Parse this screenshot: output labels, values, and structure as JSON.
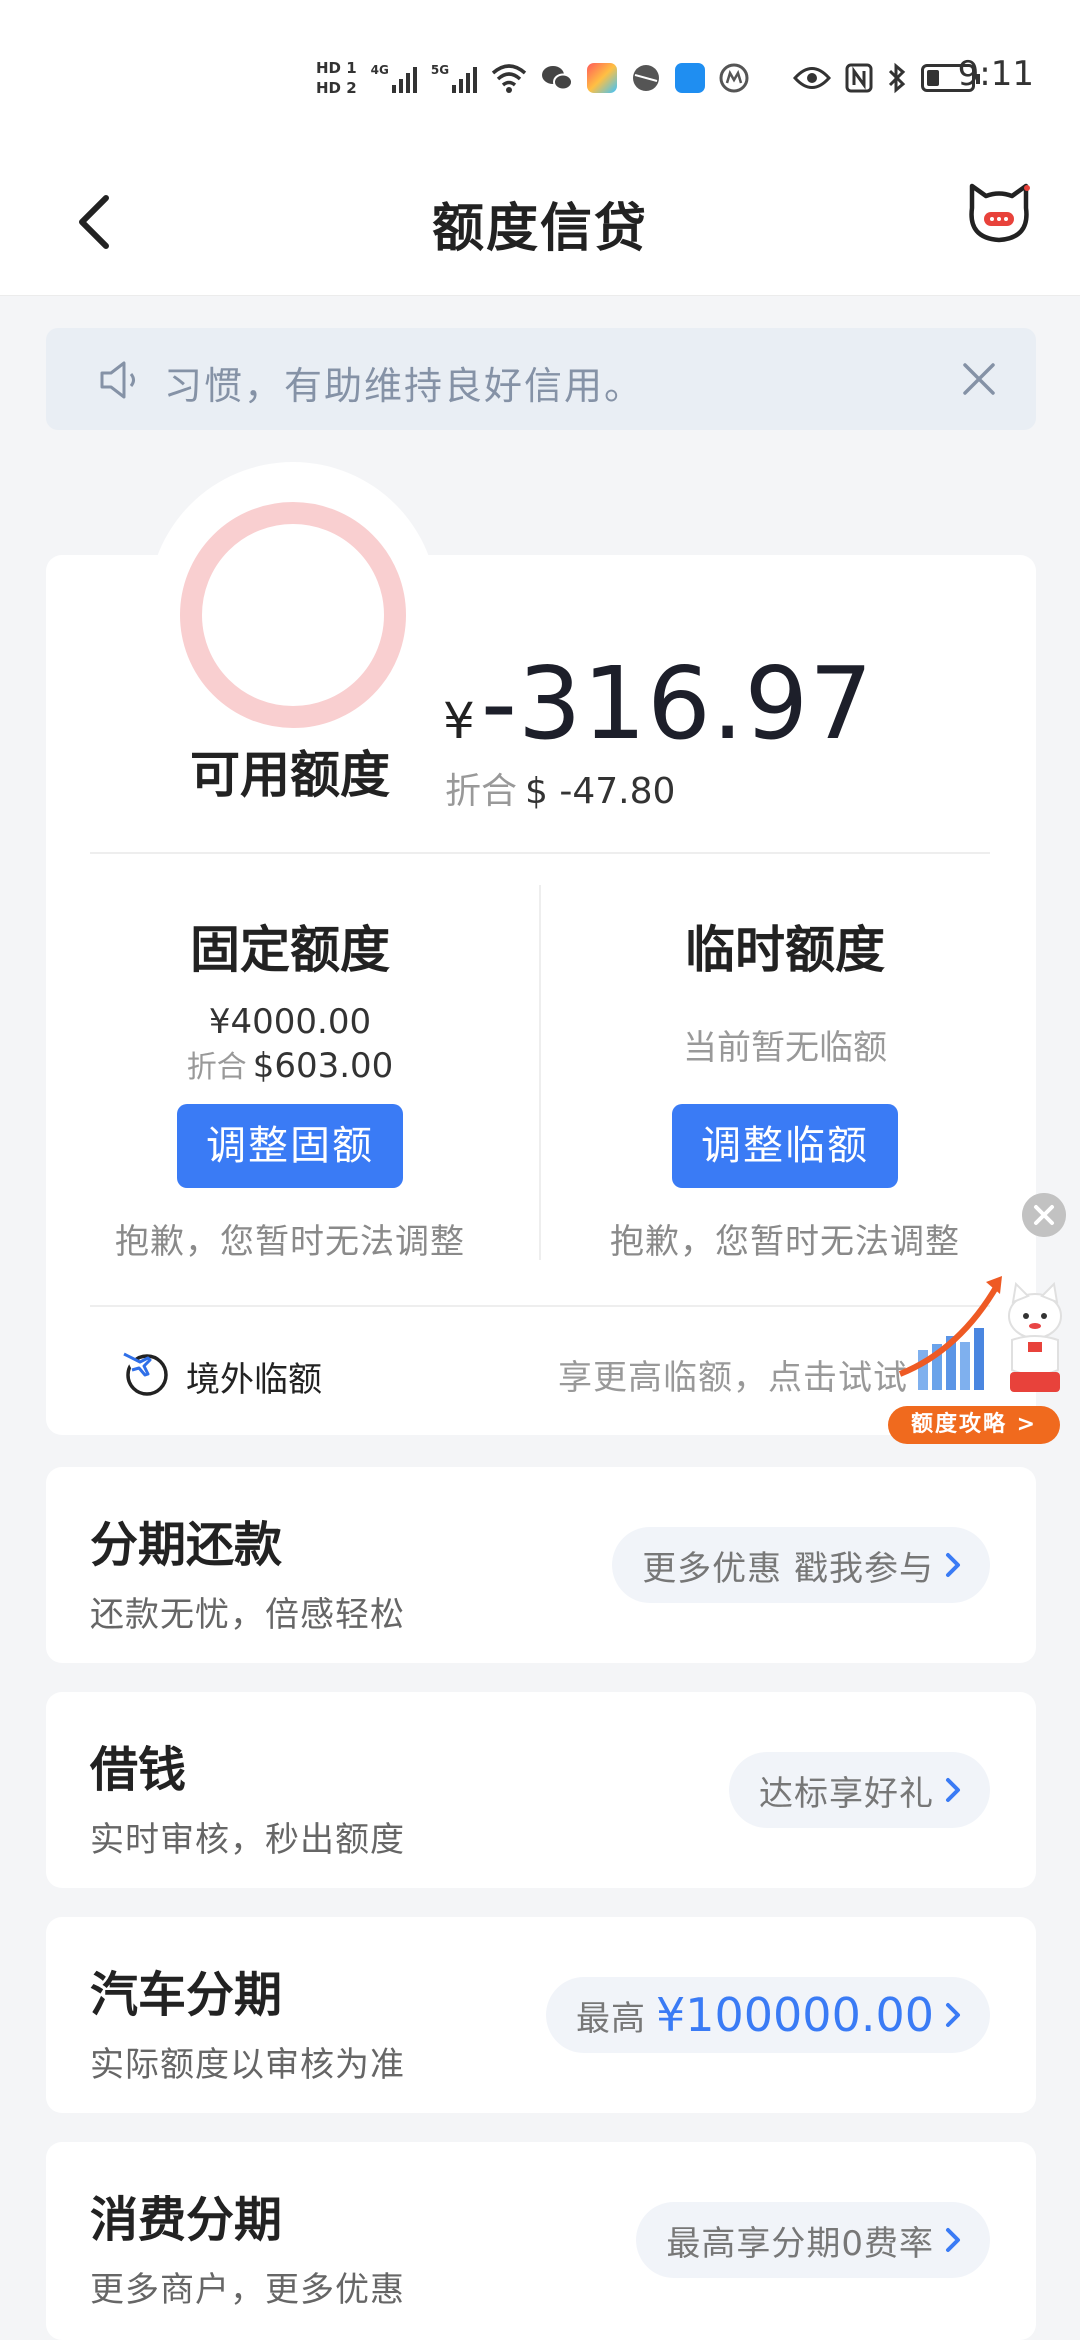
{
  "status_bar": {
    "hd1": "HD 1",
    "hd2": "HD 2",
    "net1": "4G",
    "net2": "5G",
    "time": "9:11"
  },
  "header": {
    "title": "额度信贷"
  },
  "notice": {
    "text": "习惯，有助维持良好信用。"
  },
  "credit": {
    "available_label": "可用额度",
    "currency_symbol": "¥",
    "available_value": "-316.97",
    "converted_label": "折合",
    "converted_value": "$ -47.80",
    "fixed": {
      "title": "固定额度",
      "amount": "¥4000.00",
      "converted_label": "折合",
      "converted_value": "$603.00",
      "button": "调整固额",
      "note": "抱歉，您暂时无法调整"
    },
    "temp": {
      "title": "临时额度",
      "status": "当前暂无临额",
      "button": "调整临额",
      "note": "抱歉，您暂时无法调整"
    },
    "overseas": {
      "label": "境外临额",
      "tip": "享更高临额，点击试试"
    }
  },
  "promo": {
    "tag": "额度攻略 >"
  },
  "products": [
    {
      "title": "分期还款",
      "subtitle": "还款无忧，倍感轻松",
      "pill": "更多优惠 戳我参与"
    },
    {
      "title": "借钱",
      "subtitle": "实时审核，秒出额度",
      "pill": "达标享好礼"
    },
    {
      "title": "汽车分期",
      "subtitle": "实际额度以审核为准",
      "pill_prefix": "最高",
      "pill_amount": "¥100000.00"
    },
    {
      "title": "消费分期",
      "subtitle": "更多商户，更多优惠",
      "pill": "最高享分期0费率"
    }
  ],
  "colors": {
    "accent": "#3a7bf5",
    "ring": "#f9cfd0",
    "promo": "#f06a1e"
  }
}
